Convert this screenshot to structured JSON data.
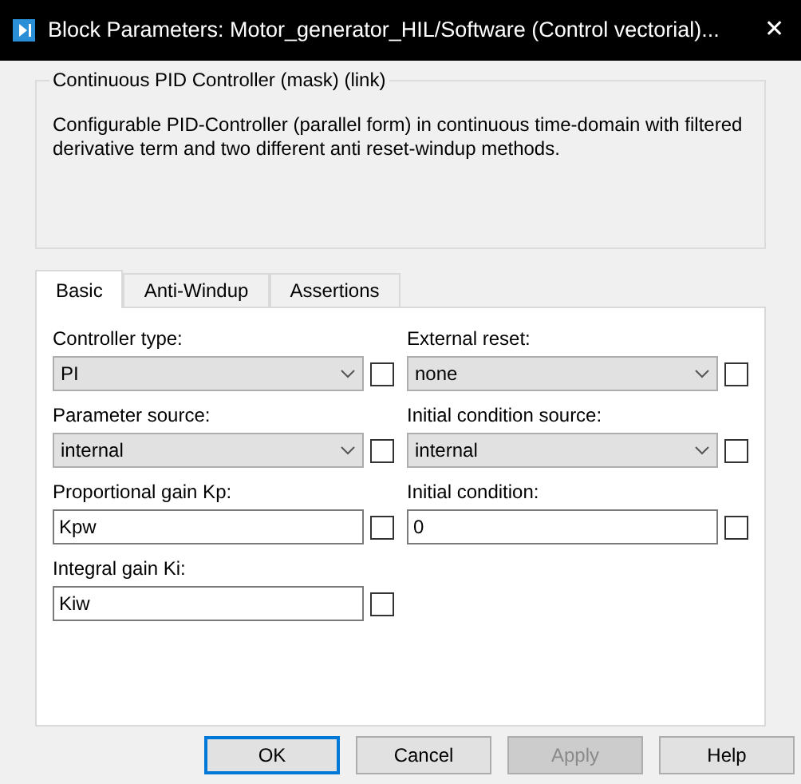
{
  "window": {
    "title": "Block Parameters: Motor_generator_HIL/Software (Control vectorial)...",
    "close": "✕"
  },
  "group": {
    "title": "Continuous PID Controller (mask) (link)",
    "description": "Configurable PID-Controller (parallel form) in continuous time-domain with filtered derivative term and two different anti reset-windup methods."
  },
  "tabs": [
    {
      "label": "Basic",
      "selected": true
    },
    {
      "label": "Anti-Windup",
      "selected": false
    },
    {
      "label": "Assertions",
      "selected": false
    }
  ],
  "parameters": [
    {
      "label": "Controller type:",
      "kind": "dropdown",
      "value": "PI",
      "checked": false
    },
    {
      "label": "External reset:",
      "kind": "dropdown",
      "value": "none",
      "checked": false
    },
    {
      "label": "Parameter source:",
      "kind": "dropdown",
      "value": "internal",
      "checked": false
    },
    {
      "label": "Initial condition source:",
      "kind": "dropdown",
      "value": "internal",
      "checked": false
    },
    {
      "label": "Proportional gain Kp:",
      "kind": "text",
      "value": "Kpw",
      "checked": false
    },
    {
      "label": "Initial condition:",
      "kind": "text",
      "value": "0",
      "checked": false
    },
    {
      "label": "Integral gain Ki:",
      "kind": "text",
      "value": "Kiw",
      "checked": false
    }
  ],
  "buttons": [
    {
      "label": "OK",
      "focused": true,
      "disabled": false
    },
    {
      "label": "Cancel",
      "focused": false,
      "disabled": false
    },
    {
      "label": "Apply",
      "focused": false,
      "disabled": true
    },
    {
      "label": "Help",
      "focused": false,
      "disabled": false
    }
  ]
}
